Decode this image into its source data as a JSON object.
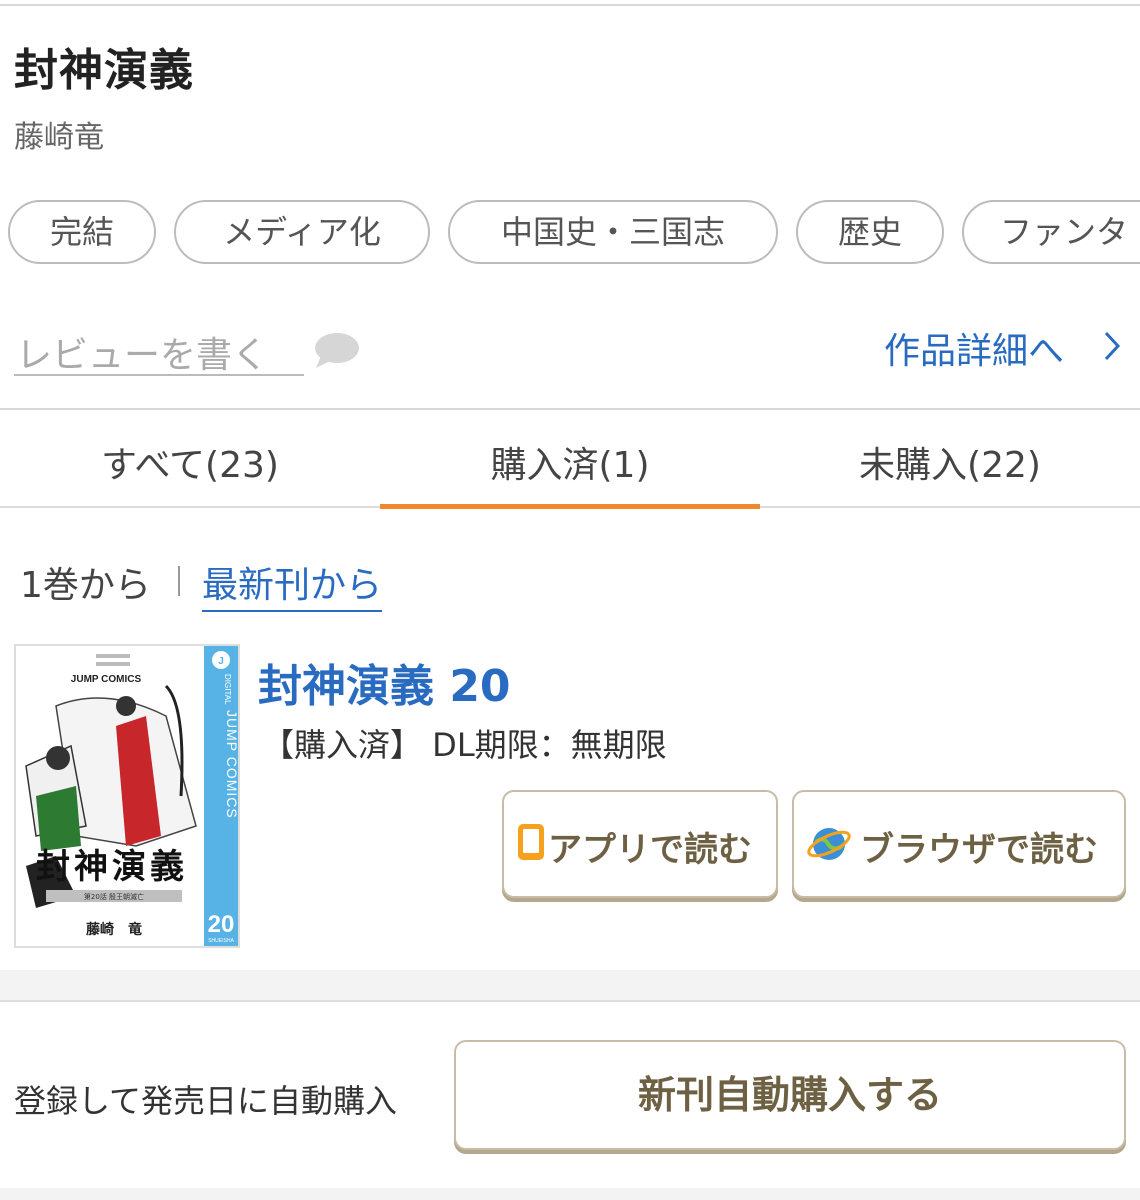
{
  "title": "封神演義",
  "author": "藤崎竜",
  "tags": [
    "完結",
    "メディア化",
    "中国史・三国志",
    "歴史",
    "ファンタ"
  ],
  "review": {
    "label": "レビューを書く",
    "icon": "speech-bubble-icon"
  },
  "detail_link": {
    "label": "作品詳細へ",
    "icon": "chevron-right-icon"
  },
  "tabs": [
    {
      "label": "すべて(23)",
      "active": false
    },
    {
      "label": "購入済(1)",
      "active": true
    },
    {
      "label": "未購入(22)",
      "active": false
    }
  ],
  "sort": {
    "from_first": "1巻から",
    "from_latest": "最新刊から"
  },
  "volume": {
    "title": "封神演義 20",
    "status": "【購入済】 DL期限：無期限",
    "cover": {
      "label_top": "JUMP COMICS",
      "spine_text": "JUMP COMICS",
      "spine_top": "DIGITAL",
      "spine_number": "20",
      "spine_publisher": "SHUEISHA",
      "title": "封神演義",
      "subtitle": "第20話  殷王朝滅亡",
      "author": "藤崎　竜"
    },
    "app_button": "アプリで読む",
    "browser_button": "ブラウザで読む"
  },
  "auto_purchase": {
    "label": "登録して発売日に自動購入",
    "button": "新刊自動購入する"
  },
  "colors": {
    "accent": "#f0892d",
    "link": "#2a6bc2",
    "button_text": "#6e6043",
    "button_border": "#c8bca6"
  }
}
